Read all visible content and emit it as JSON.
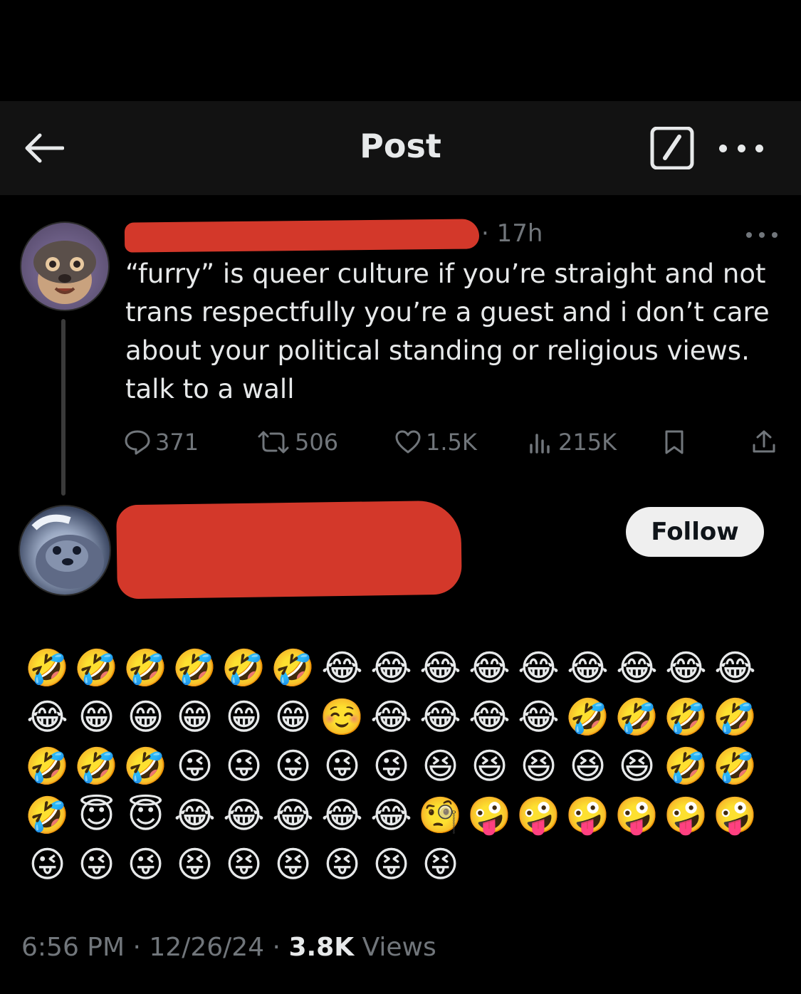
{
  "header": {
    "title": "Post",
    "back_icon": "arrow-left-icon",
    "compose_icon": "compose-icon",
    "more_icon": "more-icon"
  },
  "tweet": {
    "time": "· 17h",
    "text": "“furry” is queer culture if you’re straight and not trans respectfully you’re a guest and i don’t care about your political standing or religious views. talk to a wall",
    "replies": "371",
    "reposts": "506",
    "likes": "1.5K",
    "views": "215K"
  },
  "reply": {
    "follow_label": "Follow",
    "emoji_rows": [
      [
        "🤣",
        "🤣",
        "🤣",
        "🤣",
        "🤣",
        "🤣",
        "😂",
        "😂",
        "😂",
        "😂",
        "😂",
        "😂",
        "😂",
        "😂",
        "😂"
      ],
      [
        "😂",
        "😁",
        "😁",
        "😁",
        "😁",
        "😁",
        "☺️",
        "😂",
        "😂",
        "😂",
        "😂",
        "🤣",
        "🤣",
        "🤣",
        "🤣"
      ],
      [
        "🤣",
        "🤣",
        "🤣",
        "😜",
        "😜",
        "😜",
        "😜",
        "😜",
        "😆",
        "😆",
        "😆",
        "😆",
        "😆",
        "🤣",
        "🤣"
      ],
      [
        "🤣",
        "😇",
        "😇",
        "😂",
        "😂",
        "😂",
        "😂",
        "😂",
        "🧐",
        "🤪",
        "🤪",
        "🤪",
        "🤪",
        "🤪",
        "🤪"
      ],
      [
        "😜",
        "😜",
        "😜",
        "😝",
        "😝",
        "😝",
        "😝",
        "😝",
        "😝"
      ]
    ],
    "footer": {
      "time": "6:56 PM",
      "date": "12/26/24",
      "views_count": "3.8K",
      "views_label": "Views"
    }
  },
  "colors": {
    "background": "#000000",
    "header_bg": "#121212",
    "text": "#e7e9ea",
    "muted": "#71767b",
    "redaction": "#d3382a",
    "follow_bg": "#efefef"
  }
}
